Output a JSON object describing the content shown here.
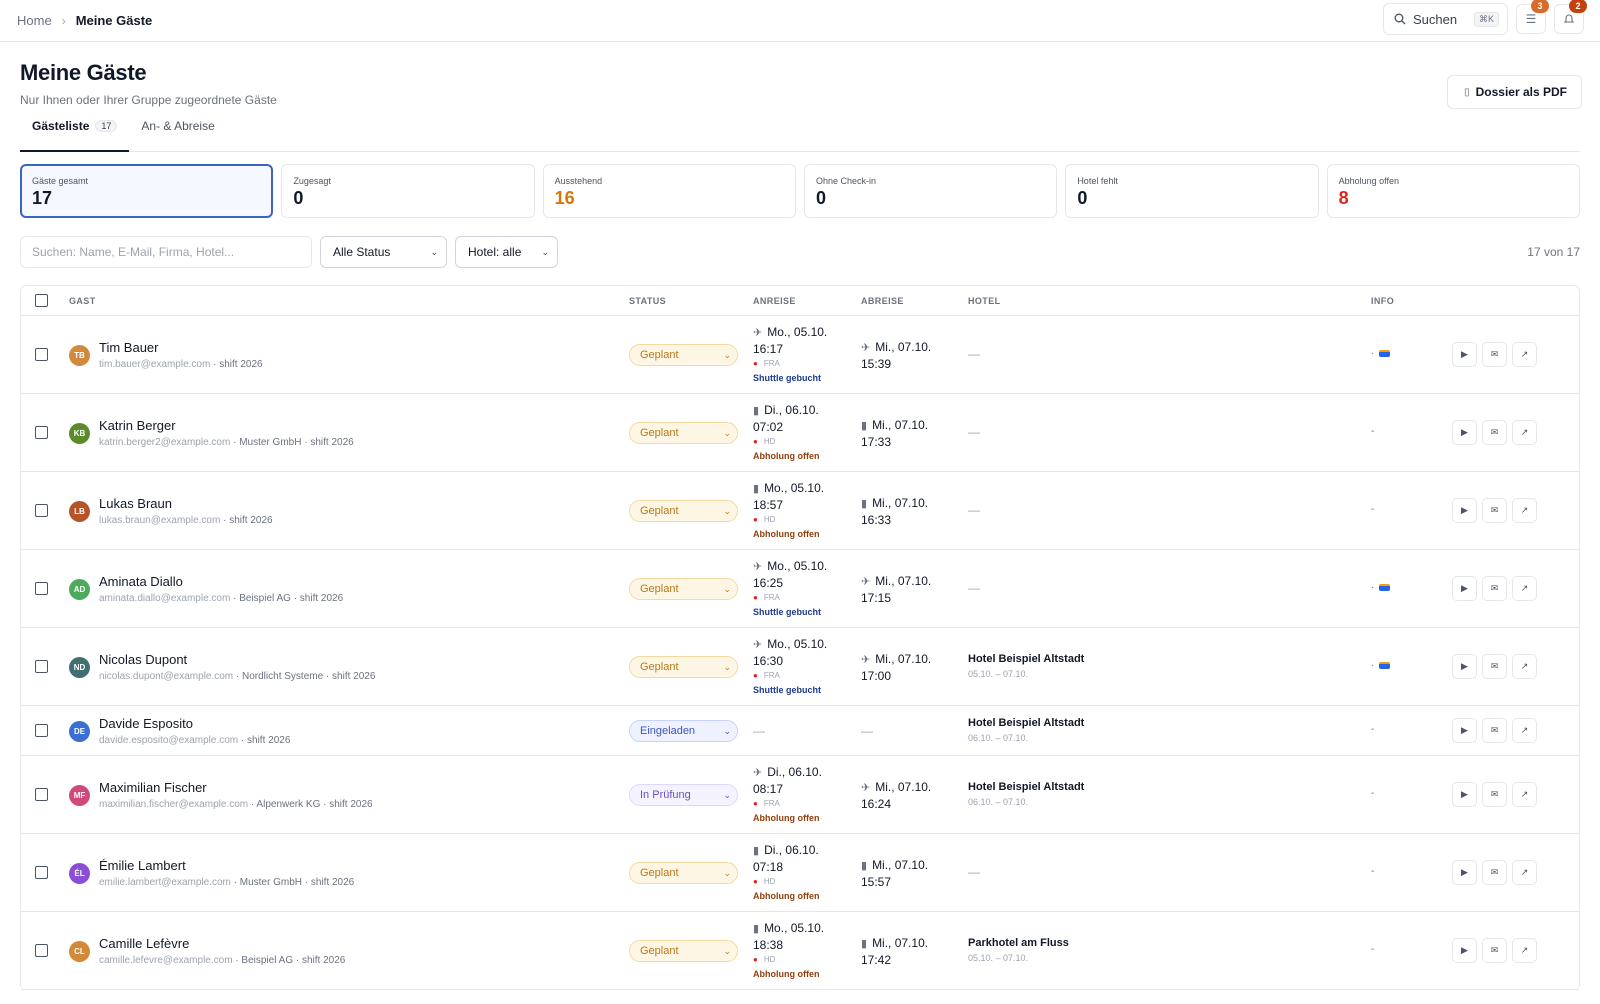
{
  "breadcrumb": {
    "home": "Home",
    "current": "Meine Gäste"
  },
  "topbar": {
    "search_label": "Suchen",
    "search_kbd": "⌘K",
    "tasks_count": "3",
    "notifications_count": "2"
  },
  "page": {
    "title": "Meine Gäste",
    "subtitle": "Nur Ihnen oder Ihrer Gruppe zugeordnete Gäste",
    "pdf_button": "Dossier als PDF"
  },
  "tabs": [
    {
      "label": "Gästeliste",
      "count": "17"
    },
    {
      "label": "An- & Abreise"
    }
  ],
  "stats": [
    {
      "label": "Gäste gesamt",
      "value": "17"
    },
    {
      "label": "Zugesagt",
      "value": "0"
    },
    {
      "label": "Ausstehend",
      "value": "16"
    },
    {
      "label": "Ohne Check-in",
      "value": "0"
    },
    {
      "label": "Hotel fehlt",
      "value": "0"
    },
    {
      "label": "Abholung offen",
      "value": "8"
    }
  ],
  "filters": {
    "search_placeholder": "Suchen: Name, E-Mail, Firma, Hotel...",
    "status": "Alle Status",
    "hotel": "Hotel: alle",
    "count": "17 von 17"
  },
  "columns": {
    "guest": "GAST",
    "status": "STATUS",
    "arrival": "ANREISE",
    "departure": "ABREISE",
    "hotel": "HOTEL",
    "info": "INFO"
  },
  "guests": [
    {
      "initials": "TB",
      "color": "#d08a3a",
      "name": "Tim Bauer",
      "email": "tim.bauer@example.com",
      "meta": " · shift 2026",
      "status": "Geplant",
      "arr_date": "Mo., 05.10.",
      "arr_time": "16:17",
      "arr_place": "FRA",
      "arr_tag": "Shuttle gebucht",
      "dep_date": "Mi., 07.10.",
      "dep_time": "15:39",
      "hotel": "—",
      "hotel_dates": "",
      "info": "·"
    },
    {
      "initials": "KB",
      "color": "#5a8a2a",
      "name": "Katrin Berger",
      "email": "katrin.berger2@example.com",
      "meta": " · Muster GmbH · shift 2026",
      "status": "Geplant",
      "arr_date": "Di., 06.10.",
      "arr_time": "07:02",
      "arr_place": "HD",
      "arr_tag": "Abholung offen",
      "dep_date": "Mi., 07.10.",
      "dep_time": "17:33",
      "hotel": "—",
      "hotel_dates": "",
      "info": "-"
    },
    {
      "initials": "LB",
      "color": "#b5542a",
      "name": "Lukas Braun",
      "email": "lukas.braun@example.com",
      "meta": " · shift 2026",
      "status": "Geplant",
      "arr_date": "Mo., 05.10.",
      "arr_time": "18:57",
      "arr_place": "HD",
      "arr_tag": "Abholung offen",
      "dep_date": "Mi., 07.10.",
      "dep_time": "16:33",
      "hotel": "—",
      "hotel_dates": "",
      "info": "-"
    },
    {
      "initials": "AD",
      "color": "#4caa5a",
      "name": "Aminata Diallo",
      "email": "aminata.diallo@example.com",
      "meta": " · Beispiel AG · shift 2026",
      "status": "Geplant",
      "arr_date": "Mo., 05.10.",
      "arr_time": "16:25",
      "arr_place": "FRA",
      "arr_tag": "Shuttle gebucht",
      "dep_date": "Mi., 07.10.",
      "dep_time": "17:15",
      "hotel": "—",
      "hotel_dates": "",
      "info": "·"
    },
    {
      "initials": "ND",
      "color": "#3f6f73",
      "name": "Nicolas Dupont",
      "email": "nicolas.dupont@example.com",
      "meta": " · Nordlicht Systeme · shift 2026",
      "status": "Geplant",
      "arr_date": "Mo., 05.10.",
      "arr_time": "16:30",
      "arr_place": "FRA",
      "arr_tag": "Shuttle gebucht",
      "dep_date": "Mi., 07.10.",
      "dep_time": "17:00",
      "hotel": "Hotel Beispiel Altstadt",
      "hotel_dates": "05.10. – 07.10.",
      "info": "·"
    },
    {
      "initials": "DE",
      "color": "#3b6fd4",
      "name": "Davide Esposito",
      "email": "davide.esposito@example.com",
      "meta": " · shift 2026",
      "status": "Eingeladen",
      "arr_date": "",
      "arr_time": "",
      "arr_place": "",
      "arr_tag": "",
      "dep_date": "",
      "dep_time": "",
      "hotel": "Hotel Beispiel Altstadt",
      "hotel_dates": "06.10. – 07.10.",
      "info": "-"
    },
    {
      "initials": "MF",
      "color": "#cf4a7a",
      "name": "Maximilian Fischer",
      "email": "maximilian.fischer@example.com",
      "meta": " · Alpenwerk KG · shift 2026",
      "status": "In Prüfung",
      "arr_date": "Di., 06.10.",
      "arr_time": "08:17",
      "arr_place": "FRA",
      "arr_tag": "Abholung offen",
      "dep_date": "Mi., 07.10.",
      "dep_time": "16:24",
      "hotel": "Hotel Beispiel Altstadt",
      "hotel_dates": "06.10. – 07.10.",
      "info": "-"
    },
    {
      "initials": "ÉL",
      "color": "#8a4fd4",
      "name": "Émilie Lambert",
      "email": "emilie.lambert@example.com",
      "meta": " · Muster GmbH · shift 2026",
      "status": "Geplant",
      "arr_date": "Di., 06.10.",
      "arr_time": "07:18",
      "arr_place": "HD",
      "arr_tag": "Abholung offen",
      "dep_date": "Mi., 07.10.",
      "dep_time": "15:57",
      "hotel": "—",
      "hotel_dates": "",
      "info": "-"
    },
    {
      "initials": "CL",
      "color": "#d08a3a",
      "name": "Camille Lefèvre",
      "email": "camille.lefevre@example.com",
      "meta": " · Beispiel AG · shift 2026",
      "status": "Geplant",
      "arr_date": "Mo., 05.10.",
      "arr_time": "18:38",
      "arr_place": "HD",
      "arr_tag": "Abholung offen",
      "dep_date": "Mi., 07.10.",
      "dep_time": "17:42",
      "hotel": "Parkhotel am Fluss",
      "hotel_dates": "05.10. – 07.10.",
      "info": "-"
    }
  ]
}
